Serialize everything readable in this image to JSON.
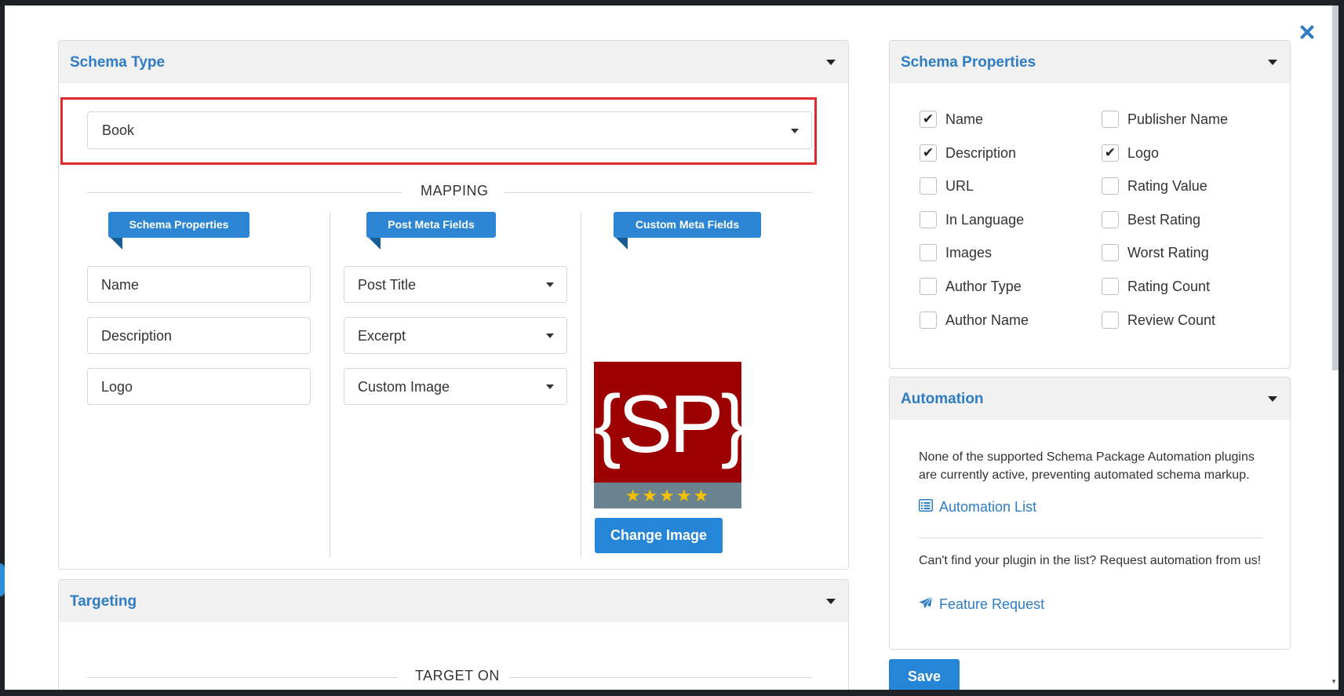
{
  "modal": {
    "close_icon": "×"
  },
  "schema_type": {
    "title": "Schema Type",
    "selected": "Book",
    "mapping_label": "MAPPING",
    "columns": {
      "schema_properties": "Schema Properties",
      "post_meta_fields": "Post Meta Fields",
      "custom_meta_fields": "Custom Meta Fields"
    },
    "rows": [
      {
        "property": "Name",
        "meta": "Post Title"
      },
      {
        "property": "Description",
        "meta": "Excerpt"
      },
      {
        "property": "Logo",
        "meta": "Custom Image"
      }
    ],
    "logo_text": "{SP}",
    "logo_stars": "★★★★★",
    "change_image": "Change Image"
  },
  "targeting": {
    "title": "Targeting",
    "target_on_label": "TARGET ON"
  },
  "schema_properties": {
    "title": "Schema Properties",
    "check_mark": "✔",
    "left": [
      {
        "label": "Name",
        "checked": true
      },
      {
        "label": "Description",
        "checked": true
      },
      {
        "label": "URL",
        "checked": false
      },
      {
        "label": "In Language",
        "checked": false
      },
      {
        "label": "Images",
        "checked": false
      },
      {
        "label": "Author Type",
        "checked": false
      },
      {
        "label": "Author Name",
        "checked": false
      }
    ],
    "right": [
      {
        "label": "Publisher Name",
        "checked": false
      },
      {
        "label": "Logo",
        "checked": true
      },
      {
        "label": "Rating Value",
        "checked": false
      },
      {
        "label": "Best Rating",
        "checked": false
      },
      {
        "label": "Worst Rating",
        "checked": false
      },
      {
        "label": "Rating Count",
        "checked": false
      },
      {
        "label": "Review Count",
        "checked": false
      }
    ]
  },
  "automation": {
    "title": "Automation",
    "notice": "None of the supported Schema Package Automation plugins are currently active, preventing automated schema markup.",
    "list_link": "Automation List",
    "request_text": "Can't find your plugin in the list? Request automation from us!",
    "feature_link": "Feature Request"
  },
  "save_label": "Save"
}
